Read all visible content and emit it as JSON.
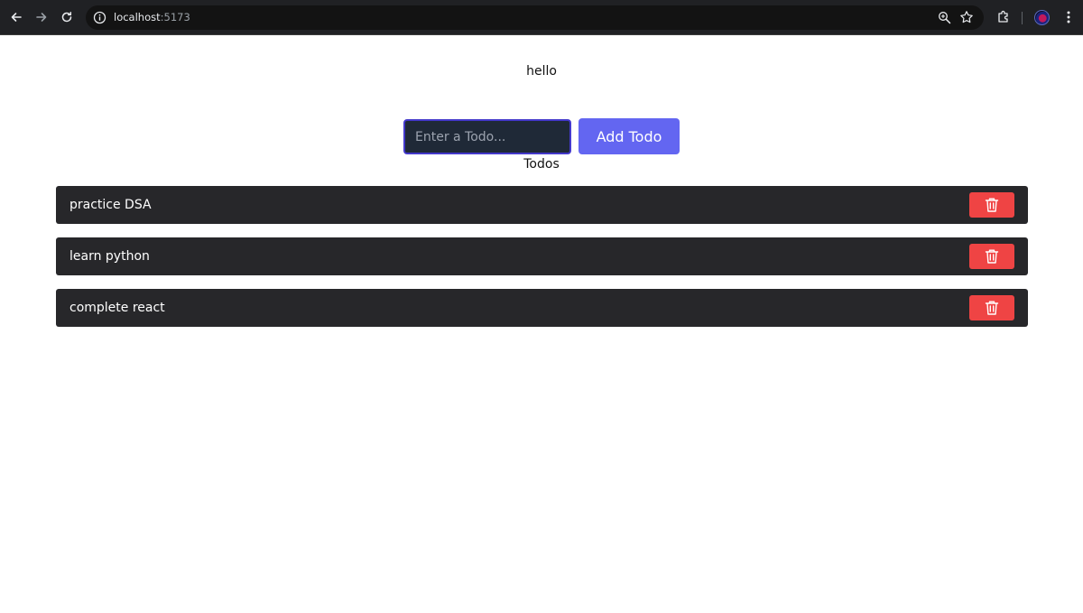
{
  "browser": {
    "url_host": "localhost",
    "url_port": ":5173",
    "icons": {
      "back": "back-arrow-icon",
      "forward": "forward-arrow-icon",
      "reload": "reload-icon",
      "site_info": "info-icon",
      "zoom": "zoom-icon",
      "bookmark": "star-icon",
      "extensions": "puzzle-icon",
      "menu": "kebab-menu-icon"
    }
  },
  "app": {
    "greeting": "hello",
    "input": {
      "value": "",
      "placeholder": "Enter a Todo..."
    },
    "add_button_label": "Add Todo",
    "list_heading": "Todos",
    "todos": [
      {
        "text": "practice DSA"
      },
      {
        "text": "learn python"
      },
      {
        "text": "complete react"
      }
    ],
    "delete_icon": "trash-icon"
  },
  "colors": {
    "input_bg": "#1f2937",
    "input_border": "#4338ca",
    "add_button": "#6366f1",
    "todo_row": "#27272a",
    "delete_button": "#ef4444"
  }
}
